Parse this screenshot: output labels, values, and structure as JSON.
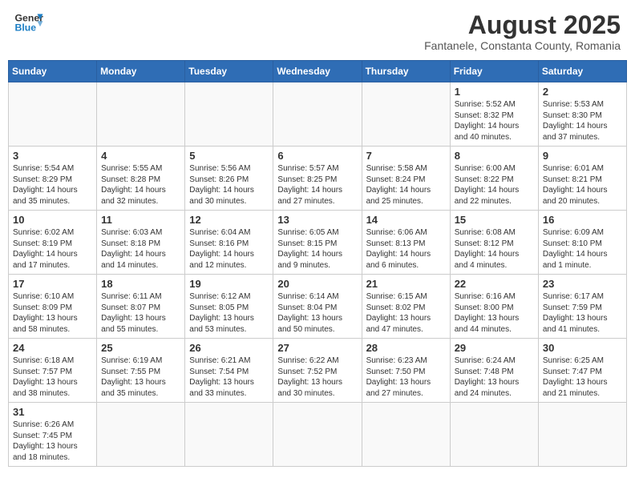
{
  "logo": {
    "general": "General",
    "blue": "Blue"
  },
  "title": "August 2025",
  "subtitle": "Fantanele, Constanta County, Romania",
  "days_of_week": [
    "Sunday",
    "Monday",
    "Tuesday",
    "Wednesday",
    "Thursday",
    "Friday",
    "Saturday"
  ],
  "weeks": [
    [
      {
        "day": "",
        "info": ""
      },
      {
        "day": "",
        "info": ""
      },
      {
        "day": "",
        "info": ""
      },
      {
        "day": "",
        "info": ""
      },
      {
        "day": "",
        "info": ""
      },
      {
        "day": "1",
        "info": "Sunrise: 5:52 AM\nSunset: 8:32 PM\nDaylight: 14 hours and 40 minutes."
      },
      {
        "day": "2",
        "info": "Sunrise: 5:53 AM\nSunset: 8:30 PM\nDaylight: 14 hours and 37 minutes."
      }
    ],
    [
      {
        "day": "3",
        "info": "Sunrise: 5:54 AM\nSunset: 8:29 PM\nDaylight: 14 hours and 35 minutes."
      },
      {
        "day": "4",
        "info": "Sunrise: 5:55 AM\nSunset: 8:28 PM\nDaylight: 14 hours and 32 minutes."
      },
      {
        "day": "5",
        "info": "Sunrise: 5:56 AM\nSunset: 8:26 PM\nDaylight: 14 hours and 30 minutes."
      },
      {
        "day": "6",
        "info": "Sunrise: 5:57 AM\nSunset: 8:25 PM\nDaylight: 14 hours and 27 minutes."
      },
      {
        "day": "7",
        "info": "Sunrise: 5:58 AM\nSunset: 8:24 PM\nDaylight: 14 hours and 25 minutes."
      },
      {
        "day": "8",
        "info": "Sunrise: 6:00 AM\nSunset: 8:22 PM\nDaylight: 14 hours and 22 minutes."
      },
      {
        "day": "9",
        "info": "Sunrise: 6:01 AM\nSunset: 8:21 PM\nDaylight: 14 hours and 20 minutes."
      }
    ],
    [
      {
        "day": "10",
        "info": "Sunrise: 6:02 AM\nSunset: 8:19 PM\nDaylight: 14 hours and 17 minutes."
      },
      {
        "day": "11",
        "info": "Sunrise: 6:03 AM\nSunset: 8:18 PM\nDaylight: 14 hours and 14 minutes."
      },
      {
        "day": "12",
        "info": "Sunrise: 6:04 AM\nSunset: 8:16 PM\nDaylight: 14 hours and 12 minutes."
      },
      {
        "day": "13",
        "info": "Sunrise: 6:05 AM\nSunset: 8:15 PM\nDaylight: 14 hours and 9 minutes."
      },
      {
        "day": "14",
        "info": "Sunrise: 6:06 AM\nSunset: 8:13 PM\nDaylight: 14 hours and 6 minutes."
      },
      {
        "day": "15",
        "info": "Sunrise: 6:08 AM\nSunset: 8:12 PM\nDaylight: 14 hours and 4 minutes."
      },
      {
        "day": "16",
        "info": "Sunrise: 6:09 AM\nSunset: 8:10 PM\nDaylight: 14 hours and 1 minute."
      }
    ],
    [
      {
        "day": "17",
        "info": "Sunrise: 6:10 AM\nSunset: 8:09 PM\nDaylight: 13 hours and 58 minutes."
      },
      {
        "day": "18",
        "info": "Sunrise: 6:11 AM\nSunset: 8:07 PM\nDaylight: 13 hours and 55 minutes."
      },
      {
        "day": "19",
        "info": "Sunrise: 6:12 AM\nSunset: 8:05 PM\nDaylight: 13 hours and 53 minutes."
      },
      {
        "day": "20",
        "info": "Sunrise: 6:14 AM\nSunset: 8:04 PM\nDaylight: 13 hours and 50 minutes."
      },
      {
        "day": "21",
        "info": "Sunrise: 6:15 AM\nSunset: 8:02 PM\nDaylight: 13 hours and 47 minutes."
      },
      {
        "day": "22",
        "info": "Sunrise: 6:16 AM\nSunset: 8:00 PM\nDaylight: 13 hours and 44 minutes."
      },
      {
        "day": "23",
        "info": "Sunrise: 6:17 AM\nSunset: 7:59 PM\nDaylight: 13 hours and 41 minutes."
      }
    ],
    [
      {
        "day": "24",
        "info": "Sunrise: 6:18 AM\nSunset: 7:57 PM\nDaylight: 13 hours and 38 minutes."
      },
      {
        "day": "25",
        "info": "Sunrise: 6:19 AM\nSunset: 7:55 PM\nDaylight: 13 hours and 35 minutes."
      },
      {
        "day": "26",
        "info": "Sunrise: 6:21 AM\nSunset: 7:54 PM\nDaylight: 13 hours and 33 minutes."
      },
      {
        "day": "27",
        "info": "Sunrise: 6:22 AM\nSunset: 7:52 PM\nDaylight: 13 hours and 30 minutes."
      },
      {
        "day": "28",
        "info": "Sunrise: 6:23 AM\nSunset: 7:50 PM\nDaylight: 13 hours and 27 minutes."
      },
      {
        "day": "29",
        "info": "Sunrise: 6:24 AM\nSunset: 7:48 PM\nDaylight: 13 hours and 24 minutes."
      },
      {
        "day": "30",
        "info": "Sunrise: 6:25 AM\nSunset: 7:47 PM\nDaylight: 13 hours and 21 minutes."
      }
    ],
    [
      {
        "day": "31",
        "info": "Sunrise: 6:26 AM\nSunset: 7:45 PM\nDaylight: 13 hours and 18 minutes."
      },
      {
        "day": "",
        "info": ""
      },
      {
        "day": "",
        "info": ""
      },
      {
        "day": "",
        "info": ""
      },
      {
        "day": "",
        "info": ""
      },
      {
        "day": "",
        "info": ""
      },
      {
        "day": "",
        "info": ""
      }
    ]
  ]
}
